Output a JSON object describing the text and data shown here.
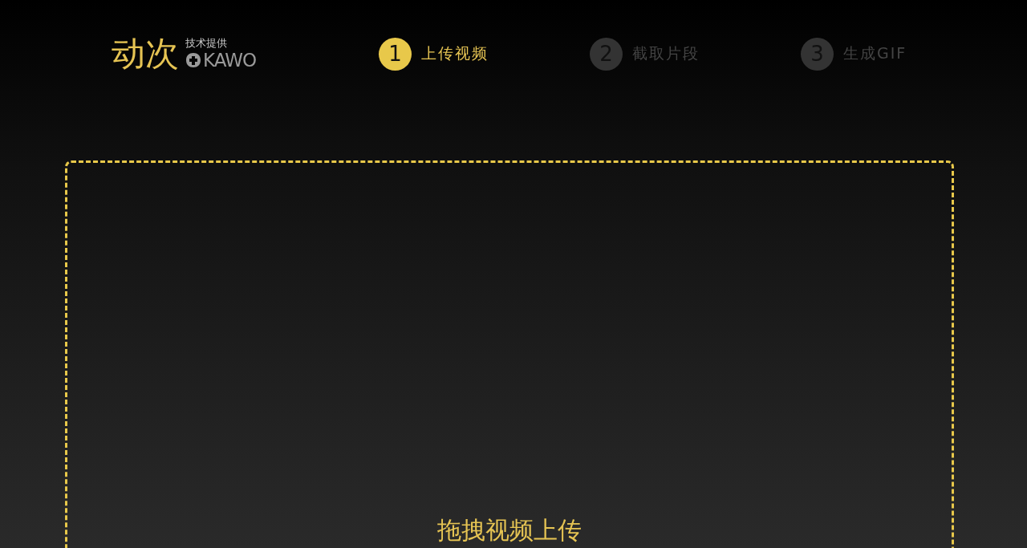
{
  "logo": {
    "name": "动次",
    "credit": "技术提供",
    "brand": "KAWO"
  },
  "steps": [
    {
      "number": "1",
      "label": "上传视频",
      "selected": true
    },
    {
      "number": "2",
      "label": "截取片段",
      "selected": false
    },
    {
      "number": "3",
      "label": "生成GIF",
      "selected": false
    }
  ],
  "dropzone": {
    "prompt": "拖拽视频上传"
  }
}
